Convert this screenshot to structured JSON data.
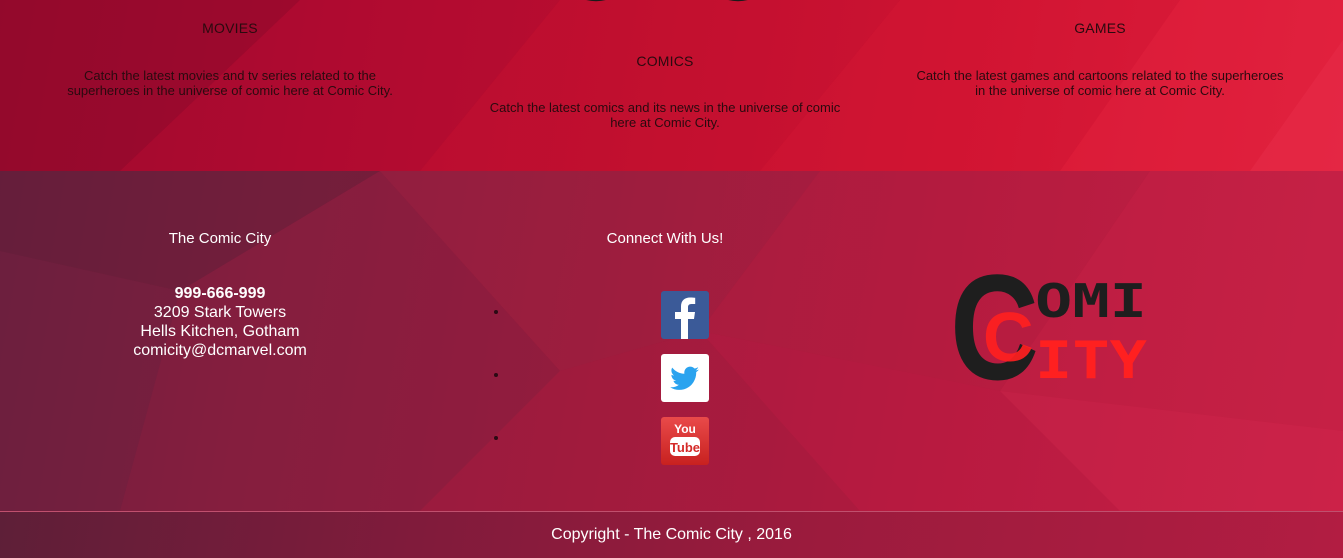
{
  "features": [
    {
      "title": "MOVIES",
      "text_line1": "Catch the latest movies and tv series related to the",
      "text_line2": "superheroes in the universe of comic here at Comic City."
    },
    {
      "title": "COMICS",
      "text_line1": "Catch the latest comics and its news in the universe of comic",
      "text_line2": "here at Comic City."
    },
    {
      "title": "GAMES",
      "text_line1": "Catch the latest games and cartoons related to the superheroes",
      "text_line2": "in the universe of comic here at Comic City."
    }
  ],
  "footer": {
    "about_heading": "The Comic City",
    "phone": "999-666-999",
    "address_line1": "3209 Stark Towers",
    "address_line2": "Hells Kitchen, Gotham",
    "email": "comicity@dcmarvel.com",
    "connect_heading": "Connect With Us!",
    "social": [
      {
        "name": "facebook",
        "icon": "facebook-icon"
      },
      {
        "name": "twitter",
        "icon": "twitter-icon"
      },
      {
        "name": "youtube",
        "icon": "youtube-icon",
        "text_top": "You",
        "text_bottom": "Tube"
      }
    ],
    "logo": {
      "row1": "OMI",
      "row2": "ITY",
      "initial": "C",
      "colors": {
        "dark": "#1e1e1e",
        "red": "#ff2020"
      }
    }
  },
  "copyright": "Copyright - The Comic City , 2016"
}
